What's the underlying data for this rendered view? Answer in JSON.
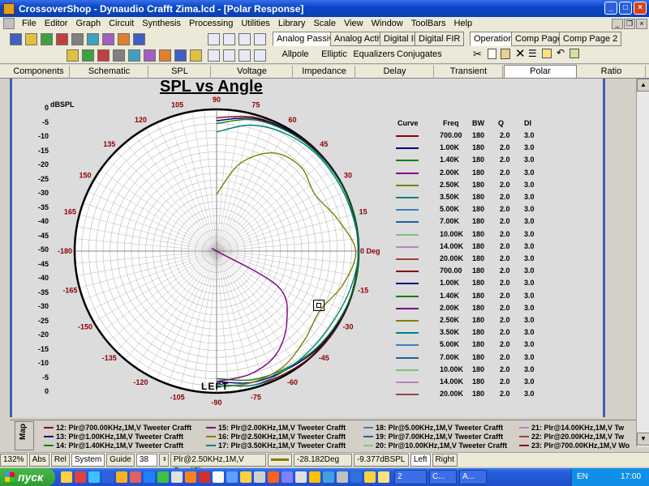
{
  "window": {
    "title": "CrossoverShop - Dynaudio Crafft Zima.lcd - [Polar Response]",
    "controls": [
      "_",
      "□",
      "×"
    ]
  },
  "menu": [
    "File",
    "Editor",
    "Graph",
    "Circuit",
    "Synthesis",
    "Processing",
    "Utilities",
    "Library",
    "Scale",
    "View",
    "Window",
    "ToolBars",
    "Help"
  ],
  "filter_tabs": {
    "row1": [
      "Analog Passive",
      "Analog Active",
      "Digital IIR",
      "Digital FIR"
    ],
    "row2": [
      "Allpole",
      "Elliptic",
      "Equalizers",
      "Conjugates"
    ],
    "ops": [
      "Operations",
      "Comp Page 1",
      "Comp Page 2"
    ]
  },
  "view_tabs": [
    "Components",
    "Schematic",
    "SPL",
    "Voltage",
    "Impedance",
    "Delay",
    "Transient",
    "Polar",
    "Ratio"
  ],
  "active_view": "Polar",
  "chart": {
    "title": "SPL vs Angle",
    "db_unit": "dBSPL",
    "db_labels": [
      "0",
      "-5",
      "-10",
      "-15",
      "-20",
      "-25",
      "-30",
      "-35",
      "-40",
      "-45",
      "-50",
      "-45",
      "-40",
      "-35",
      "-30",
      "-25",
      "-20",
      "-15",
      "-10",
      "-5",
      "0"
    ],
    "side_label": "Left",
    "zero_label": "0 Deg"
  },
  "chart_data": {
    "type": "scatter",
    "title": "SPL vs Angle",
    "angle_unit": "deg",
    "angle_labels": [
      {
        "deg": 90,
        "text": "90"
      },
      {
        "deg": 75,
        "text": "75"
      },
      {
        "deg": 60,
        "text": "60"
      },
      {
        "deg": 45,
        "text": "45"
      },
      {
        "deg": 30,
        "text": "30"
      },
      {
        "deg": 15,
        "text": "15"
      },
      {
        "deg": 0,
        "text": "0 Deg"
      },
      {
        "deg": -15,
        "text": "-15"
      },
      {
        "deg": -30,
        "text": "-30"
      },
      {
        "deg": -45,
        "text": "-45"
      },
      {
        "deg": -60,
        "text": "-60"
      },
      {
        "deg": -75,
        "text": "-75"
      },
      {
        "deg": -90,
        "text": "-90"
      },
      {
        "deg": -105,
        "text": "-105"
      },
      {
        "deg": -120,
        "text": "-120"
      },
      {
        "deg": -135,
        "text": "-135"
      },
      {
        "deg": -150,
        "text": "-150"
      },
      {
        "deg": -165,
        "text": "-165"
      },
      {
        "deg": 180,
        "text": "-180"
      },
      {
        "deg": 165,
        "text": "165"
      },
      {
        "deg": 150,
        "text": "150"
      },
      {
        "deg": 135,
        "text": "135"
      },
      {
        "deg": 120,
        "text": "120"
      },
      {
        "deg": 105,
        "text": "105"
      }
    ],
    "radial_range_db": [
      -50,
      0
    ],
    "series": [
      {
        "color": "#8b0000",
        "points": [
          [
            90,
            -3
          ],
          [
            75,
            -1
          ],
          [
            60,
            -0.5
          ],
          [
            45,
            0
          ],
          [
            30,
            0
          ],
          [
            15,
            0
          ],
          [
            0,
            0
          ],
          [
            -15,
            0
          ],
          [
            -30,
            0
          ],
          [
            -45,
            0
          ],
          [
            -60,
            -0.5
          ],
          [
            -75,
            -1
          ],
          [
            -90,
            -3
          ]
        ]
      },
      {
        "color": "#000080",
        "points": [
          [
            90,
            -4
          ],
          [
            75,
            -1.5
          ],
          [
            60,
            -0.6
          ],
          [
            45,
            -0.2
          ],
          [
            30,
            0
          ],
          [
            15,
            0
          ],
          [
            0,
            0
          ],
          [
            -15,
            0
          ],
          [
            -30,
            -0.2
          ],
          [
            -45,
            -0.6
          ],
          [
            -60,
            -1.5
          ],
          [
            -75,
            -2
          ],
          [
            -90,
            -4
          ]
        ]
      },
      {
        "color": "#008000",
        "points": [
          [
            90,
            -5
          ],
          [
            75,
            -2
          ],
          [
            60,
            -1
          ],
          [
            45,
            -0.5
          ],
          [
            30,
            -0.2
          ],
          [
            15,
            0
          ],
          [
            0,
            0
          ],
          [
            -15,
            0
          ],
          [
            -30,
            -0.5
          ],
          [
            -45,
            -1
          ],
          [
            -60,
            -2
          ],
          [
            -75,
            -3
          ],
          [
            -90,
            -5
          ]
        ]
      },
      {
        "color": "#800080",
        "points": [
          [
            90,
            -50
          ],
          [
            75,
            -50
          ],
          [
            60,
            -50
          ],
          [
            45,
            -50
          ],
          [
            30,
            -50
          ],
          [
            15,
            -50
          ],
          [
            0,
            -50
          ],
          [
            -15,
            -50
          ],
          [
            -30,
            -25
          ],
          [
            -45,
            -15
          ],
          [
            -60,
            -8
          ],
          [
            -75,
            -5
          ],
          [
            -90,
            -4
          ]
        ]
      },
      {
        "color": "#808000",
        "points": [
          [
            90,
            -30
          ],
          [
            75,
            -18
          ],
          [
            60,
            -10
          ],
          [
            45,
            -8
          ],
          [
            30,
            -10
          ],
          [
            15,
            -6
          ],
          [
            0,
            -1
          ],
          [
            -15,
            -4
          ],
          [
            -30,
            -8
          ],
          [
            -45,
            -6
          ],
          [
            -60,
            -3
          ],
          [
            -75,
            -2
          ],
          [
            -90,
            -2
          ]
        ]
      },
      {
        "color": "#008080",
        "points": [
          [
            90,
            -8
          ],
          [
            75,
            -4
          ],
          [
            60,
            -2
          ],
          [
            45,
            -1
          ],
          [
            30,
            -0.8
          ],
          [
            15,
            -0.5
          ],
          [
            0,
            0
          ],
          [
            -15,
            -1
          ],
          [
            -30,
            -2
          ],
          [
            -45,
            -2
          ],
          [
            -60,
            -1.5
          ],
          [
            -75,
            -1
          ],
          [
            -90,
            -3
          ]
        ]
      }
    ]
  },
  "table": {
    "headers": [
      "Curve",
      "Freq",
      "BW",
      "Q",
      "DI"
    ],
    "rows": [
      {
        "color": "#8b0000",
        "freq": "700.00",
        "bw": "180",
        "q": "2.0",
        "di": "3.0"
      },
      {
        "color": "#000080",
        "freq": "1.00K",
        "bw": "180",
        "q": "2.0",
        "di": "3.0"
      },
      {
        "color": "#008000",
        "freq": "1.40K",
        "bw": "180",
        "q": "2.0",
        "di": "3.0"
      },
      {
        "color": "#800080",
        "freq": "2.00K",
        "bw": "180",
        "q": "2.0",
        "di": "3.0"
      },
      {
        "color": "#808000",
        "freq": "2.50K",
        "bw": "180",
        "q": "2.0",
        "di": "3.0"
      },
      {
        "color": "#008080",
        "freq": "3.50K",
        "bw": "180",
        "q": "2.0",
        "di": "3.0"
      },
      {
        "color": "#4080c0",
        "freq": "5.00K",
        "bw": "180",
        "q": "2.0",
        "di": "3.0"
      },
      {
        "color": "#2060a0",
        "freq": "7.00K",
        "bw": "180",
        "q": "2.0",
        "di": "3.0"
      },
      {
        "color": "#80c080",
        "freq": "10.00K",
        "bw": "180",
        "q": "2.0",
        "di": "3.0"
      },
      {
        "color": "#c080c0",
        "freq": "14.00K",
        "bw": "180",
        "q": "2.0",
        "di": "3.0"
      },
      {
        "color": "#a04040",
        "freq": "20.00K",
        "bw": "180",
        "q": "2.0",
        "di": "3.0"
      },
      {
        "color": "#8b0000",
        "freq": "700.00",
        "bw": "180",
        "q": "2.0",
        "di": "3.0"
      },
      {
        "color": "#000080",
        "freq": "1.00K",
        "bw": "180",
        "q": "2.0",
        "di": "3.0"
      },
      {
        "color": "#008000",
        "freq": "1.40K",
        "bw": "180",
        "q": "2.0",
        "di": "3.0"
      },
      {
        "color": "#800080",
        "freq": "2.00K",
        "bw": "180",
        "q": "2.0",
        "di": "3.0"
      },
      {
        "color": "#808000",
        "freq": "2.50K",
        "bw": "180",
        "q": "2.0",
        "di": "3.0"
      },
      {
        "color": "#008080",
        "freq": "3.50K",
        "bw": "180",
        "q": "2.0",
        "di": "3.0"
      },
      {
        "color": "#4080c0",
        "freq": "5.00K",
        "bw": "180",
        "q": "2.0",
        "di": "3.0"
      },
      {
        "color": "#2060a0",
        "freq": "7.00K",
        "bw": "180",
        "q": "2.0",
        "di": "3.0"
      },
      {
        "color": "#80c080",
        "freq": "10.00K",
        "bw": "180",
        "q": "2.0",
        "di": "3.0"
      },
      {
        "color": "#c080c0",
        "freq": "14.00K",
        "bw": "180",
        "q": "2.0",
        "di": "3.0"
      },
      {
        "color": "#a04040",
        "freq": "20.00K",
        "bw": "180",
        "q": "2.0",
        "di": "3.0"
      }
    ]
  },
  "map_tab": "Map",
  "legend": [
    {
      "text": "12: Plr@700.00KHz,1M,V Tweeter Crafft",
      "color": "#8b0000"
    },
    {
      "text": "13: Plr@1.00KHz,1M,V Tweeter Crafft",
      "color": "#000080"
    },
    {
      "text": "14: Plr@1.40KHz,1M,V Tweeter Crafft",
      "color": "#008000"
    },
    {
      "text": "15: Plr@2.00KHz,1M,V Tweeter Crafft",
      "color": "#800080"
    },
    {
      "text": "16: Plr@2.50KHz,1M,V Tweeter Crafft",
      "color": "#808000"
    },
    {
      "text": "17: Plr@3.50KHz,1M,V Tweeter Crafft",
      "color": "#008080"
    },
    {
      "text": "18: Plr@5.00KHz,1M,V Tweeter Crafft",
      "color": "#4080c0"
    },
    {
      "text": "19: Plr@7.00KHz,1M,V Tweeter Crafft",
      "color": "#2060a0"
    },
    {
      "text": "20: Plr@10.00KHz,1M,V Tweeter Crafft",
      "color": "#80c080"
    },
    {
      "text": "21: Plr@14.00KHz,1M,V Tw",
      "color": "#c080c0"
    },
    {
      "text": "22: Plr@20.00KHz,1M,V Tw",
      "color": "#a04040"
    },
    {
      "text": "23: Plr@700.00KHz,1M,V Wo",
      "color": "#8b0000"
    }
  ],
  "status": {
    "zoom": "132%",
    "abs": "Abs",
    "rel": "Rel",
    "system": "System",
    "guide": "Guide",
    "guide_value": "38",
    "curve": "Plr@2.50KHz,1M,V Sum(C)",
    "curve_color": "#808000",
    "angle": "-28.182Deg",
    "level": "-9.377dBSPL",
    "left": "Left",
    "right": "Right"
  },
  "taskbar": {
    "start": "пуск",
    "tasks": [
      "2",
      "C...",
      "A..."
    ],
    "lang": "EN",
    "time": "17:00"
  }
}
